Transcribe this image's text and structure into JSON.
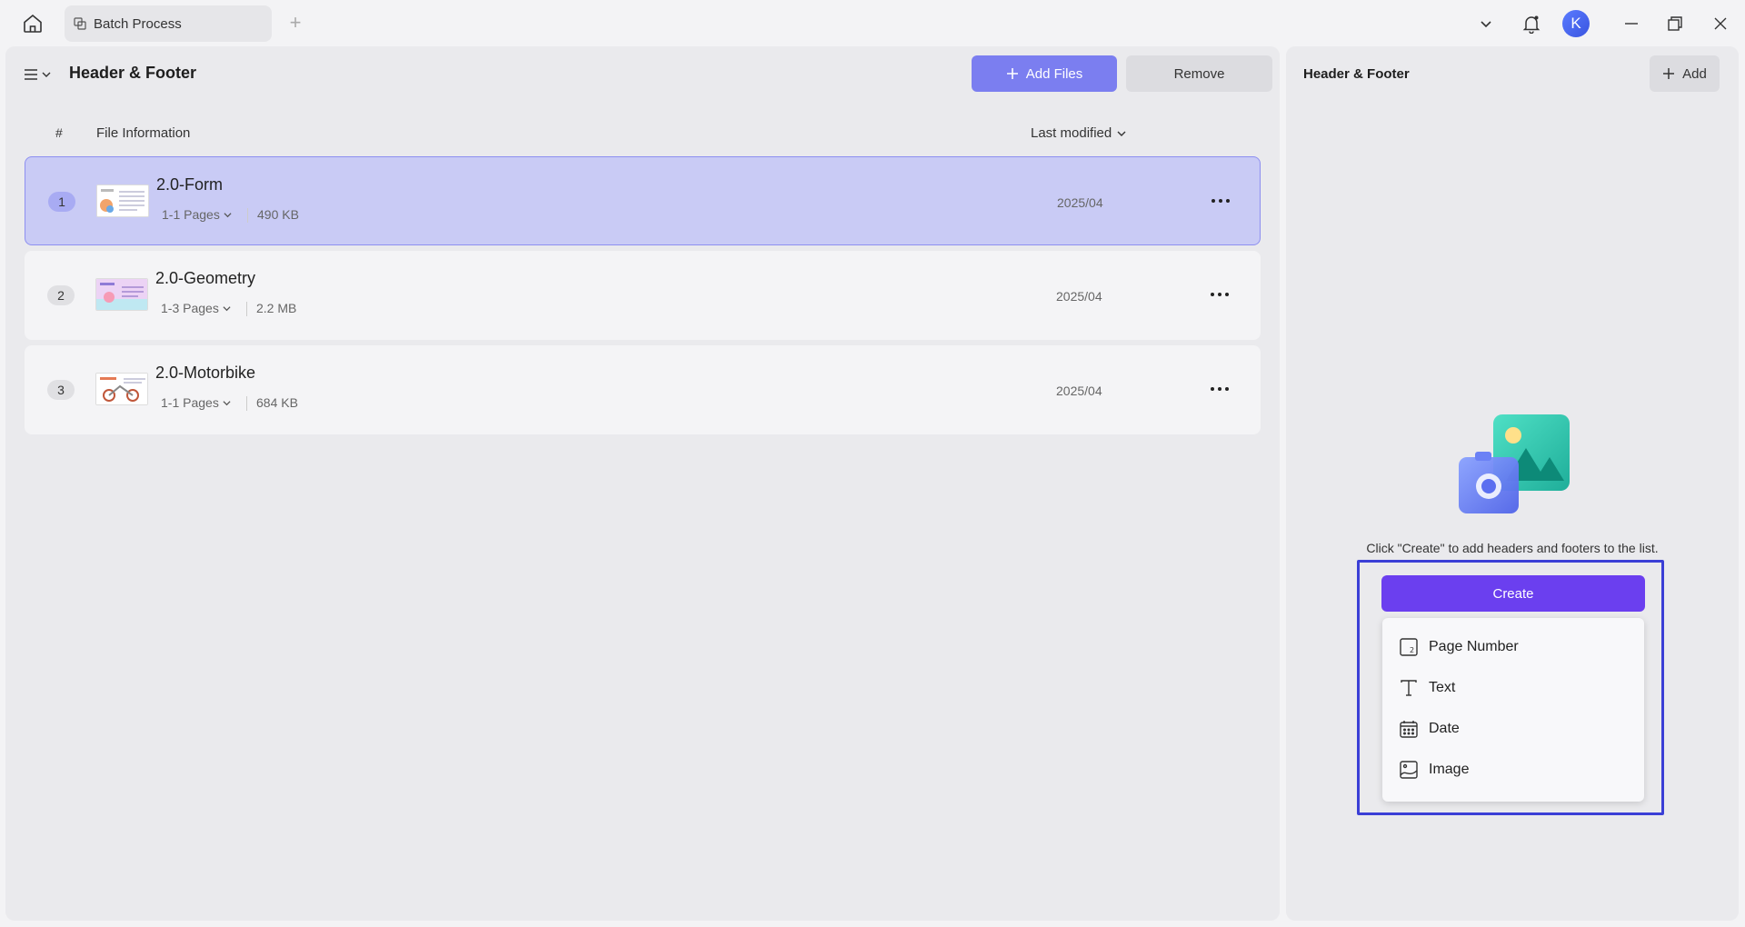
{
  "titlebar": {
    "tab_label": "Batch Process",
    "avatar_initial": "K"
  },
  "main": {
    "title": "Header & Footer",
    "add_files_label": "Add Files",
    "remove_label": "Remove",
    "columns": {
      "hash": "#",
      "info": "File Information",
      "modified": "Last modified"
    },
    "files": [
      {
        "num": "1",
        "name": "2.0-Form",
        "pages": "1-1 Pages",
        "size": "490 KB",
        "date": "2025/04",
        "selected": true
      },
      {
        "num": "2",
        "name": "2.0-Geometry",
        "pages": "1-3 Pages",
        "size": "2.2 MB",
        "date": "2025/04",
        "selected": false
      },
      {
        "num": "3",
        "name": "2.0-Motorbike",
        "pages": "1-1 Pages",
        "size": "684 KB",
        "date": "2025/04",
        "selected": false
      }
    ]
  },
  "side": {
    "title": "Header & Footer",
    "add_label": "Add",
    "hint": "Click \"Create\" to add headers and footers to the list.",
    "create_label": "Create",
    "menu": [
      {
        "label": "Page Number",
        "icon": "page-number-icon"
      },
      {
        "label": "Text",
        "icon": "text-icon"
      },
      {
        "label": "Date",
        "icon": "calendar-icon"
      },
      {
        "label": "Image",
        "icon": "image-icon"
      }
    ]
  },
  "colors": {
    "accent": "#7b7ef0",
    "create": "#6b3fef",
    "highlight": "#3b3fd6",
    "selected_row": "#c9cbf5"
  }
}
